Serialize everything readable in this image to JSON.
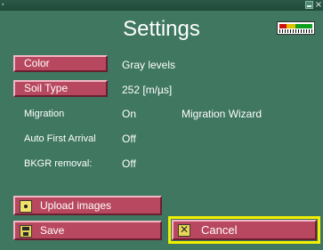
{
  "window": {
    "title": "",
    "close_glyph": "×",
    "minimize_icon": "minimize-icon"
  },
  "page": {
    "title": "Settings"
  },
  "status": {
    "battery_icon": "battery-level-icon"
  },
  "settings": {
    "color": {
      "label": "Color",
      "value": "Gray levels"
    },
    "soil_type": {
      "label": "Soil Type",
      "value": "252  [m/µs]"
    },
    "migration": {
      "label": "Migration",
      "value": "On",
      "wizard_label": "Migration Wizard"
    },
    "auto_first_arrival": {
      "label": "Auto First Arrival",
      "value": "Off"
    },
    "bkgr_removal": {
      "label": "BKGR removal:",
      "value": "Off"
    }
  },
  "actions": {
    "upload_label": "Upload images",
    "save_label": "Save",
    "cancel_label": "Cancel"
  },
  "colors": {
    "background": "#3f7760",
    "button_fill": "#b8485f",
    "focus_ring": "#f0f000",
    "text": "#ffffff"
  }
}
